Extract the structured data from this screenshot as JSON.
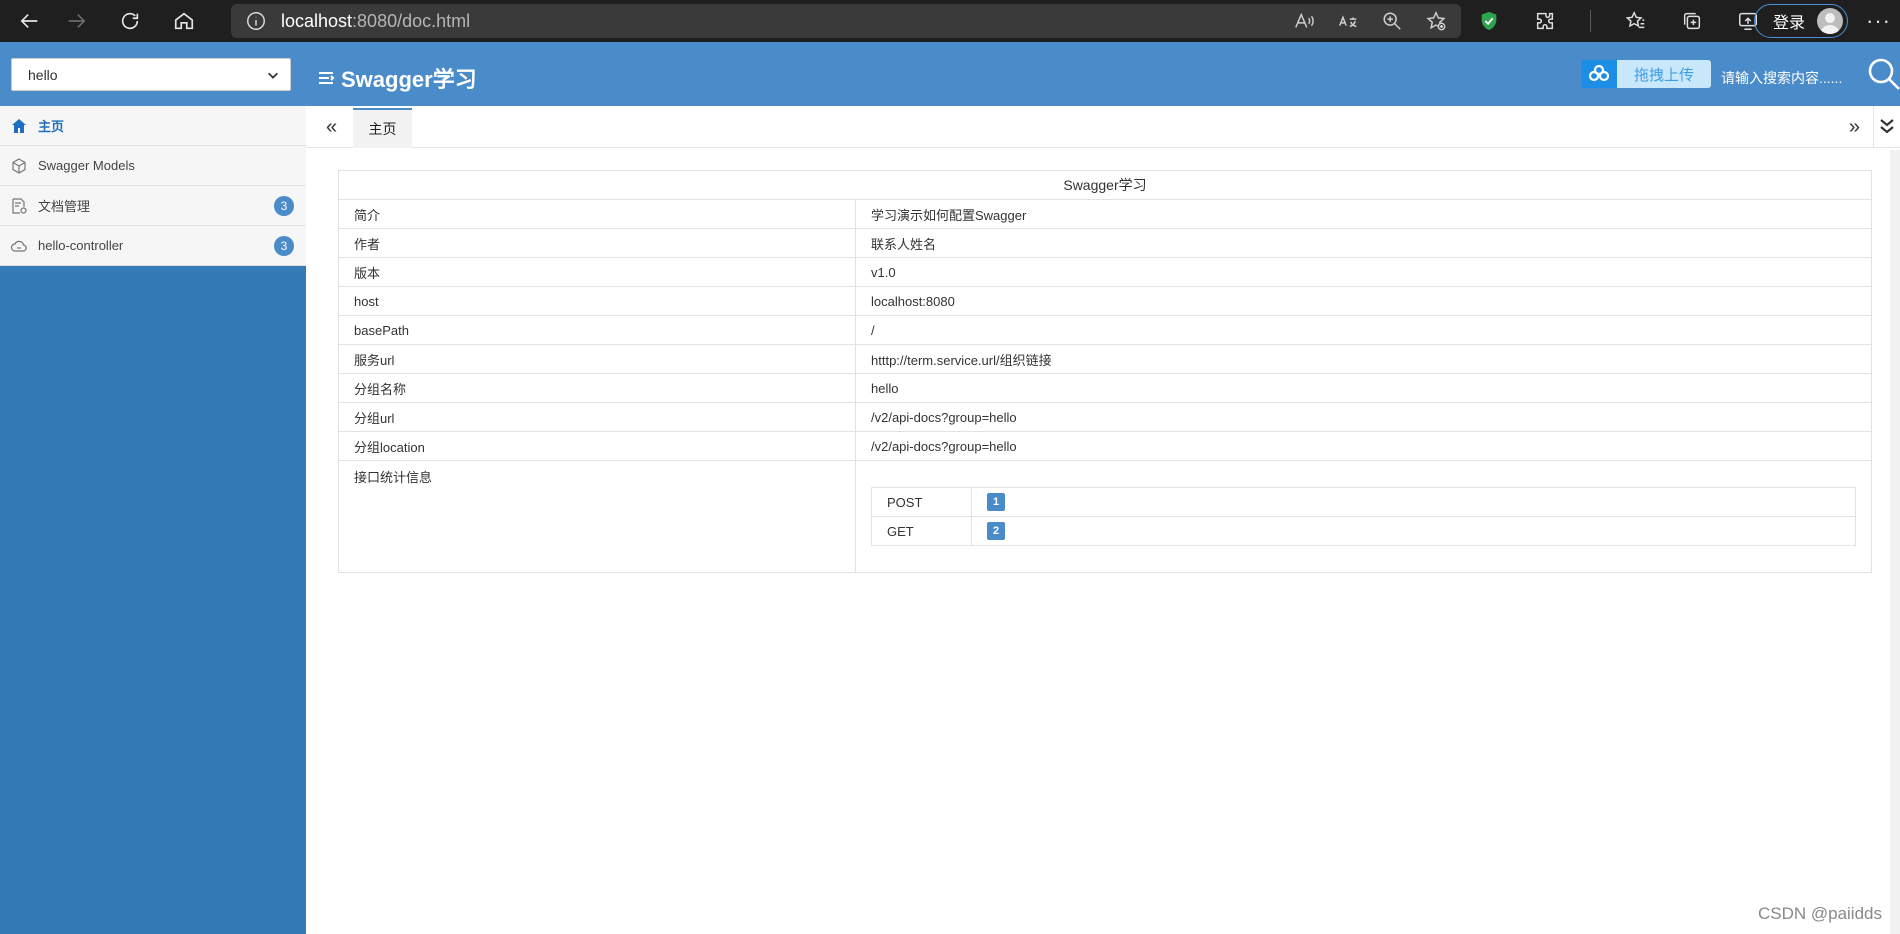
{
  "browser": {
    "url_host": "localhost",
    "url_rest": ":8080/doc.html",
    "login_label": "登录",
    "more_label": "···"
  },
  "header": {
    "group_selected": "hello",
    "title": "Swagger学习",
    "upload_label": "拖拽上传",
    "search_placeholder": "请输入搜索内容......"
  },
  "sidebar": {
    "items": [
      {
        "label": "主页",
        "icon": "home-icon",
        "active": true
      },
      {
        "label": "Swagger Models",
        "icon": "models-icon"
      },
      {
        "label": "文档管理",
        "icon": "doc-manage-icon",
        "badge": "3"
      },
      {
        "label": "hello-controller",
        "icon": "cloud-icon",
        "badge": "3"
      }
    ]
  },
  "tabs": {
    "left_arrow": "«",
    "right_arrow": "»",
    "home_label": "主页"
  },
  "info": {
    "title": "Swagger学习",
    "rows": [
      {
        "key": "简介",
        "value": "学习演示如何配置Swagger"
      },
      {
        "key": "作者",
        "value": "联系人姓名"
      },
      {
        "key": "版本",
        "value": "v1.0"
      },
      {
        "key": "host",
        "value": "localhost:8080"
      },
      {
        "key": "basePath",
        "value": "/"
      },
      {
        "key": "服务url",
        "value": "htttp://term.service.url/组织链接"
      },
      {
        "key": "分组名称",
        "value": "hello"
      },
      {
        "key": "分组url",
        "value": "/v2/api-docs?group=hello"
      },
      {
        "key": "分组location",
        "value": "/v2/api-docs?group=hello"
      }
    ],
    "stats_label": "接口统计信息",
    "stats": [
      {
        "method": "POST",
        "count": "1"
      },
      {
        "method": "GET",
        "count": "2"
      }
    ]
  },
  "watermark": "CSDN @paiidds",
  "colors": {
    "header_blue": "#4a8bc9",
    "sidebar_blue": "#337ab7",
    "badge_blue": "#4a8bc9"
  }
}
